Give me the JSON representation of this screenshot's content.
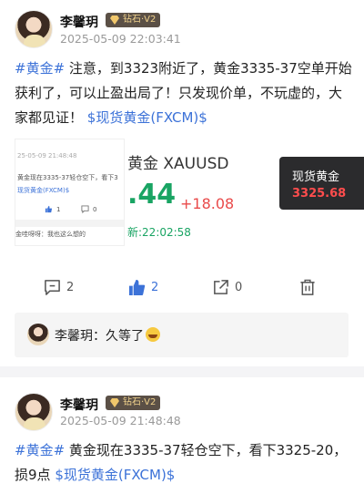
{
  "posts": [
    {
      "user": "李馨玥",
      "badge": "钻石·V2",
      "time": "2025-05-09 22:03:41",
      "tag": "#黄金#",
      "text": " 注意，到3323附近了，黄金3335-37空单开始获利了，可以止盈出局了！只发现价单，不玩虚的，大家都见证！",
      "link": "$现货黄金(FXCM)$",
      "preview_left": {
        "line1": "黄金现在3335-37轻仓空下，看下3",
        "time": "25-05-09 21:48:48",
        "link": "现货黄金(FXCM)$",
        "likes": "1",
        "comments": "0",
        "reply": "金哇呀呀：我也这么想的"
      },
      "preview_mid": {
        "name": "黄金  XAUUSD",
        "price": ".44",
        "change": "+18.08",
        "time": "新:22:02:58"
      },
      "actions": {
        "comments": "2",
        "likes": "2",
        "shares": "0"
      },
      "reply": {
        "user": "李馨玥",
        "text": "久等了"
      }
    },
    {
      "user": "李馨玥",
      "badge": "钻石·V2",
      "time": "2025-05-09 21:48:48",
      "tag": "#黄金#",
      "text": " 黄金现在3335-37轻仓空下，看下3325-20，损9点",
      "link": "$现货黄金(FXCM)$"
    }
  ],
  "quote": {
    "title": "现货黄金",
    "price": "3325.68",
    "price_color": "#ff4d4d"
  },
  "colors": {
    "link": "#3c72d8",
    "like_active": "#3c72d8",
    "price_up": "#19a463"
  },
  "icons": [
    "comment-icon",
    "thumbs-up-icon",
    "share-icon",
    "trash-icon",
    "diamond-icon"
  ]
}
